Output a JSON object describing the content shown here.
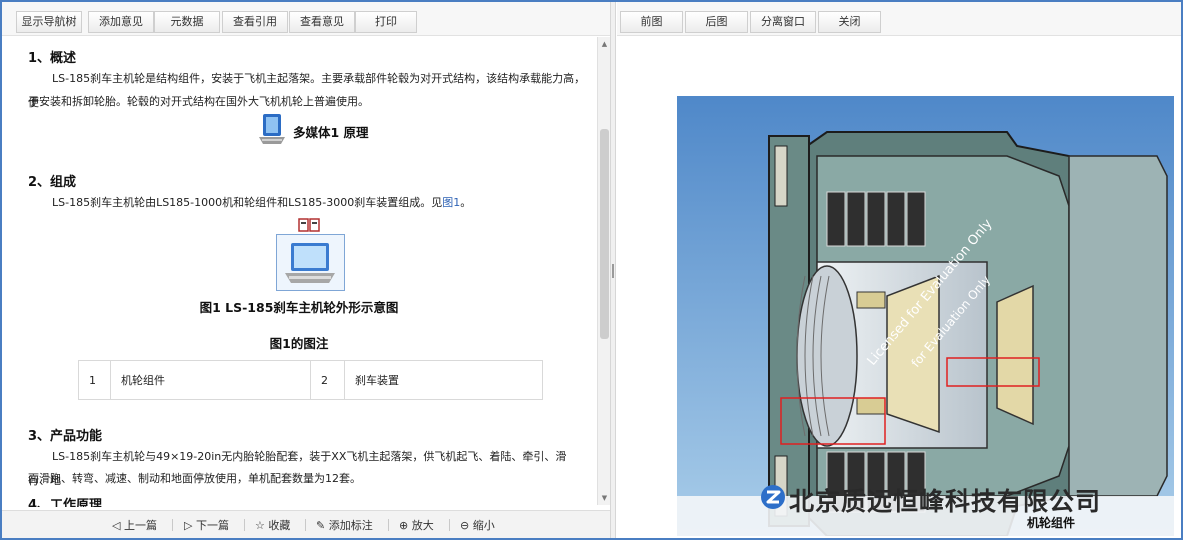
{
  "left_toolbar": {
    "buttons": [
      "显示导航树",
      "添加意见",
      "元数据",
      "查看引用",
      "查看意见",
      "打印"
    ]
  },
  "document": {
    "sections": [
      {
        "heading": "1、概述",
        "para_lines": [
          "LS-185刹车主机轮是结构组件，安装于飞机主起落架。主要承载部件轮毂为对开式结构，该结构承载能力高，便",
          "于安装和拆卸轮胎。轮毂的对开式结构在国外大飞机机轮上普遍使用。"
        ]
      },
      {
        "heading": "2、组成",
        "para_text": "LS-185刹车主机轮由LS185-1000机和轮组件和LS185-3000刹车装置组成。见",
        "para_link": "图1",
        "para_end": "。"
      },
      {
        "heading": "3、产品功能",
        "para_lines": [
          "LS-185刹车主机轮与49×19-20in无内胎轮胎配套，装于XX飞机主起落架，供飞机起飞、着陆、牵引、滑行、地",
          "面滑跑、转弯、减速、制动和地面停放使用，单机配套数量为12套。"
        ]
      },
      {
        "heading": "4、工作原理"
      }
    ],
    "multimedia_label": "多媒体1 原理",
    "figure_title": "图1 LS-185刹车主机轮外形示意图",
    "legend_title": "图1的图注",
    "legend_rows": [
      [
        "1",
        "机轮组件",
        "2",
        "刹车装置"
      ]
    ]
  },
  "bottom_toolbar": {
    "buttons": [
      {
        "icon": "◁",
        "label": "上一篇"
      },
      {
        "icon": "▷",
        "label": "下一篇"
      },
      {
        "icon": "☆",
        "label": "收藏"
      },
      {
        "icon": "✎",
        "label": "添加标注"
      },
      {
        "icon": "⊕",
        "label": "放大"
      },
      {
        "icon": "⊖",
        "label": "缩小"
      }
    ]
  },
  "right_toolbar": {
    "buttons": [
      "前图",
      "后图",
      "分离窗口",
      "关闭"
    ]
  },
  "image": {
    "watermark_lines": [
      "Licensed for Evaluation Only",
      "for Evaluation Only"
    ],
    "company_watermark": "北京质远恒峰科技有限公司",
    "caption": "机轮组件"
  },
  "colors": {
    "frame_border": "#4a7ec2",
    "link": "#2f63b5",
    "image_bg": "#6b9ad0",
    "highlight_box": "#e02020"
  }
}
